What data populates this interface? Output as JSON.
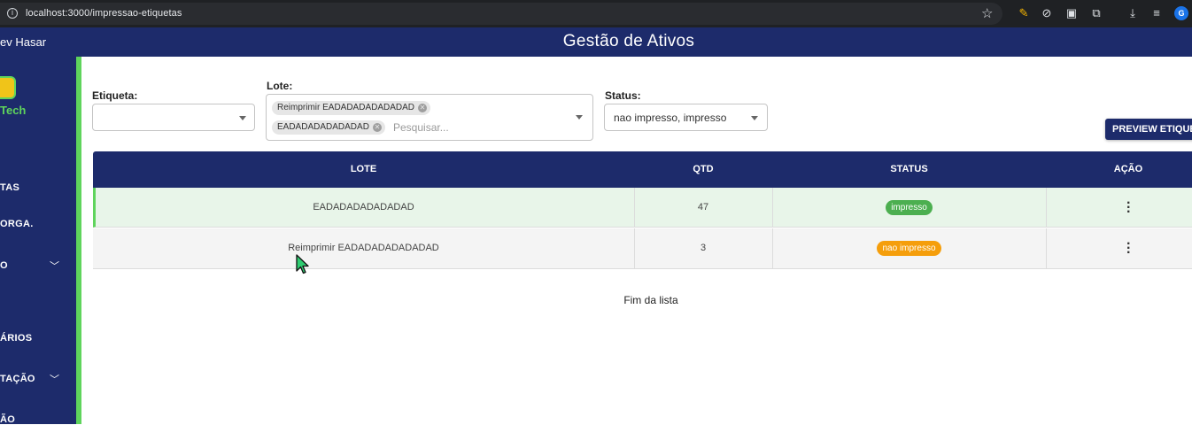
{
  "browser": {
    "url": "localhost:3000/impressao-etiquetas",
    "profile_initial": "G"
  },
  "header": {
    "user_name": "ev Hasar",
    "title": "Gestão de Ativos"
  },
  "sidebar": {
    "logo_text": "Tech",
    "items": [
      {
        "label": "TAS"
      },
      {
        "label": "ORGA."
      },
      {
        "label": "O"
      },
      {
        "label": "ÁRIOS"
      },
      {
        "label": "TAÇÃO"
      },
      {
        "label": "ÃO"
      }
    ]
  },
  "filters": {
    "etiqueta": {
      "label": "Etiqueta:",
      "value": ""
    },
    "lote": {
      "label": "Lote:",
      "chips": [
        "Reimprimir EADADADADADADAD",
        "EADADADADADADAD"
      ],
      "placeholder": "Pesquisar..."
    },
    "status": {
      "label": "Status:",
      "value": "nao impresso, impresso"
    }
  },
  "preview_button": {
    "label": "PREVIEW ETIQUETAS"
  },
  "table": {
    "headers": {
      "lote": "LOTE",
      "qtd": "QTD",
      "status": "STATUS",
      "acao": "AÇÃO"
    },
    "rows": [
      {
        "lote": "EADADADADADADAD",
        "qtd": "47",
        "status": "impresso",
        "status_color": "#4caf50",
        "row_bg": "#e8f5e9"
      },
      {
        "lote": "Reimprimir EADADADADADADAD",
        "qtd": "3",
        "status": "nao impresso",
        "status_color": "#f59e0b",
        "row_bg": "#f4f4f4"
      }
    ]
  },
  "footer_text": "Fim da lista",
  "colors": {
    "brand": "#1d2b6b",
    "accent": "#5fd45c"
  }
}
